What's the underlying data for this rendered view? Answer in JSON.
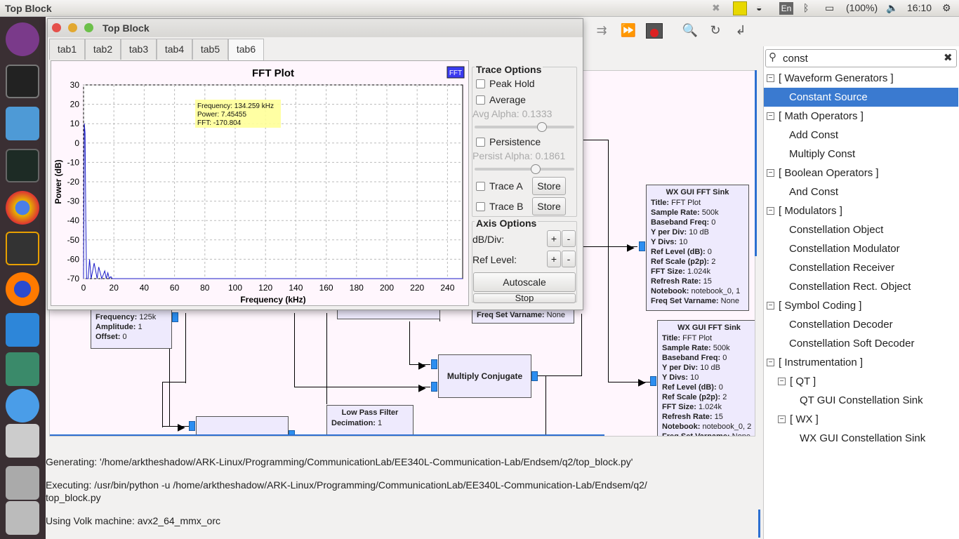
{
  "topbar": {
    "title": "Top Block",
    "lang": "En",
    "battery": "(100%)",
    "clock": "16:10"
  },
  "window": {
    "title": "Top Block",
    "tabs": [
      "tab1",
      "tab2",
      "tab3",
      "tab4",
      "tab5",
      "tab6"
    ],
    "active_tab": "tab6"
  },
  "plot": {
    "title": "FFT Plot",
    "legend": "FFT",
    "xlabel": "Frequency (kHz)",
    "ylabel": "Power (dB)",
    "tooltip": [
      "Frequency: 134.259 kHz",
      "Power: 7.45455",
      "FFT: -170.804"
    ],
    "xticks": [
      "0",
      "20",
      "40",
      "60",
      "80",
      "100",
      "120",
      "140",
      "160",
      "180",
      "200",
      "220",
      "240"
    ],
    "yticks": [
      "30",
      "20",
      "10",
      "0",
      "-10",
      "-20",
      "-30",
      "-40",
      "-50",
      "-60",
      "-70"
    ]
  },
  "chart_data": {
    "type": "line",
    "title": "FFT Plot",
    "xlabel": "Frequency (kHz)",
    "ylabel": "Power (dB)",
    "xlim": [
      0,
      250
    ],
    "ylim": [
      -70,
      30
    ],
    "grid": true,
    "legend_placement": "top-right",
    "series": [
      {
        "name": "FFT",
        "color": "#1c1cc8",
        "x": [
          0,
          0.5,
          1,
          1.5,
          2,
          3,
          4,
          5,
          6,
          7,
          8,
          9,
          10,
          11,
          12,
          13,
          14,
          15,
          16,
          17,
          18,
          19,
          20,
          22,
          24,
          30,
          40,
          60,
          80,
          100,
          120,
          140,
          160,
          180,
          200,
          220,
          240,
          250
        ],
        "y": [
          -70,
          10,
          5,
          -40,
          -70,
          -70,
          -60,
          -70,
          -66,
          -62,
          -66,
          -70,
          -64,
          -67,
          -70,
          -68,
          -66,
          -70,
          -67,
          -70,
          -69,
          -70,
          -70,
          -70,
          -70,
          -70,
          -70,
          -70,
          -70,
          -70,
          -70,
          -70,
          -70,
          -70,
          -70,
          -70,
          -70,
          -70
        ]
      }
    ]
  },
  "trace": {
    "header": "Trace Options",
    "peak_hold": "Peak Hold",
    "average": "Average",
    "avg_alpha": "Avg Alpha: 0.1333",
    "avg_alpha_value": 0.1333,
    "persistence": "Persistence",
    "persist_alpha": "Persist Alpha: 0.1861",
    "persist_alpha_value": 0.1861,
    "trace_a": "Trace A",
    "trace_b": "Trace B",
    "store": "Store",
    "axis_header": "Axis Options",
    "db_div": "dB/Div:",
    "ref_level": "Ref Level:",
    "plus": "+",
    "minus": "-",
    "autoscale": "Autoscale",
    "stop": "Stop"
  },
  "blocks": {
    "fft1": {
      "title": "WX GUI FFT Sink",
      "lines": [
        [
          "Title:",
          "FFT Plot"
        ],
        [
          "Sample Rate:",
          "500k"
        ],
        [
          "Baseband Freq:",
          "0"
        ],
        [
          "Y per Div:",
          "10 dB"
        ],
        [
          "Y Divs:",
          "10"
        ],
        [
          "Ref Level (dB):",
          "0"
        ],
        [
          "Ref Scale (p2p):",
          "2"
        ],
        [
          "FFT Size:",
          "1.024k"
        ],
        [
          "Refresh Rate:",
          "15"
        ],
        [
          "Notebook:",
          "notebook_0, 1"
        ],
        [
          "Freq Set Varname:",
          "None"
        ]
      ]
    },
    "fft2": {
      "title": "WX GUI FFT Sink",
      "lines": [
        [
          "Title:",
          "FFT Plot"
        ],
        [
          "Sample Rate:",
          "500k"
        ],
        [
          "Baseband Freq:",
          "0"
        ],
        [
          "Y per Div:",
          "10 dB"
        ],
        [
          "Y Divs:",
          "10"
        ],
        [
          "Ref Level (dB):",
          "0"
        ],
        [
          "Ref Scale (p2p):",
          "2"
        ],
        [
          "FFT Size:",
          "1.024k"
        ],
        [
          "Refresh Rate:",
          "15"
        ],
        [
          "Notebook:",
          "notebook_0, 2"
        ],
        [
          "Freq Set Varname:",
          "None"
        ]
      ]
    },
    "signal": {
      "lines": [
        [
          "Frequency:",
          "125k"
        ],
        [
          "Amplitude:",
          "1"
        ],
        [
          "Offset:",
          "0"
        ]
      ]
    },
    "multiply_conjugate": "Multiply Conjugate",
    "lpf_title": "Low Pass Filter",
    "lpf_decimation": [
      "Decimation:",
      "1"
    ],
    "partial_fft_tail": [
      "Freq Set Varname:",
      "None"
    ]
  },
  "console": [
    "Generating: '/home/arktheshadow/ARK-Linux/Programming/CommunicationLab/EE340L-Communication-Lab/Endsem/q2/top_block.py'",
    "Executing: /usr/bin/python -u /home/arktheshadow/ARK-Linux/Programming/CommunicationLab/EE340L-Communication-Lab/Endsem/q2/",
    "top_block.py",
    "Using Volk machine: avx2_64_mmx_orc"
  ],
  "search": {
    "value": "const"
  },
  "tree": [
    {
      "label": "[ Waveform Generators ]",
      "level": 0,
      "group": true
    },
    {
      "label": "Constant Source",
      "level": 1,
      "selected": true
    },
    {
      "label": "[ Math Operators ]",
      "level": 0,
      "group": true
    },
    {
      "label": "Add Const",
      "level": 1
    },
    {
      "label": "Multiply Const",
      "level": 1
    },
    {
      "label": "[ Boolean Operators ]",
      "level": 0,
      "group": true
    },
    {
      "label": "And Const",
      "level": 1
    },
    {
      "label": "[ Modulators ]",
      "level": 0,
      "group": true
    },
    {
      "label": "Constellation Object",
      "level": 1
    },
    {
      "label": "Constellation Modulator",
      "level": 1
    },
    {
      "label": "Constellation Receiver",
      "level": 1
    },
    {
      "label": "Constellation Rect. Object",
      "level": 1
    },
    {
      "label": "[ Symbol Coding ]",
      "level": 0,
      "group": true
    },
    {
      "label": "Constellation Decoder",
      "level": 1
    },
    {
      "label": "Constellation Soft Decoder",
      "level": 1
    },
    {
      "label": "[ Instrumentation ]",
      "level": 0,
      "group": true
    },
    {
      "label": "[ QT ]",
      "level": 1,
      "group": true
    },
    {
      "label": "QT GUI Constellation Sink",
      "level": 2
    },
    {
      "label": "[ WX ]",
      "level": 1,
      "group": true
    },
    {
      "label": "WX GUI Constellation Sink",
      "level": 2
    }
  ]
}
